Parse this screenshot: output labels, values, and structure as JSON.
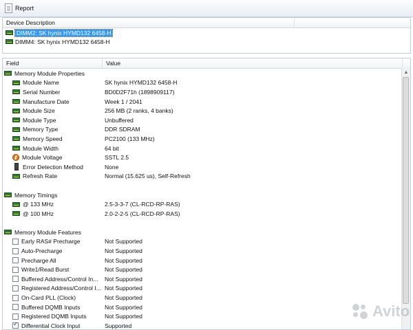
{
  "toolbar": {
    "report_label": "Report"
  },
  "devices": {
    "header": "Device Description",
    "items": [
      {
        "label": "DIMM2: SK hynix HYMD132 6458-H",
        "selected": true
      },
      {
        "label": "DIMM4: SK hynix HYMD132 6458-H",
        "selected": false
      }
    ]
  },
  "details": {
    "columns": {
      "field": "Field",
      "value": "Value"
    },
    "groups": [
      {
        "title": "Memory Module Properties",
        "rows": [
          {
            "field": "Module Name",
            "value": "SK hynix HYMD132 6458-H",
            "icon": "ram-icon"
          },
          {
            "field": "Serial Number",
            "value": "BD0D2F71h (1898909117)",
            "icon": "ram-icon"
          },
          {
            "field": "Manufacture Date",
            "value": "Week 1 / 2041",
            "icon": "ram-icon"
          },
          {
            "field": "Module Size",
            "value": "256 MB (2 ranks, 4 banks)",
            "icon": "ram-icon"
          },
          {
            "field": "Module Type",
            "value": "Unbuffered",
            "icon": "ram-icon"
          },
          {
            "field": "Memory Type",
            "value": "DDR SDRAM",
            "icon": "ram-icon"
          },
          {
            "field": "Memory Speed",
            "value": "PC2100 (133 MHz)",
            "icon": "ram-icon"
          },
          {
            "field": "Module Width",
            "value": "64 bit",
            "icon": "ram-icon"
          },
          {
            "field": "Module Voltage",
            "value": "SSTL 2.5",
            "icon": "voltage-icon"
          },
          {
            "field": "Error Detection Method",
            "value": "None",
            "icon": "device-icon"
          },
          {
            "field": "Refresh Rate",
            "value": "Normal (15.625 us), Self-Refresh",
            "icon": "ram-icon"
          }
        ]
      },
      {
        "title": "Memory Timings",
        "rows": [
          {
            "field": "@ 133 MHz",
            "value": "2.5-3-3-7  (CL-RCD-RP-RAS)",
            "icon": "ram-icon"
          },
          {
            "field": "@ 100 MHz",
            "value": "2.0-2-2-5  (CL-RCD-RP-RAS)",
            "icon": "ram-icon"
          }
        ]
      },
      {
        "title": "Memory Module Features",
        "rows": [
          {
            "field": "Early RAS# Precharge",
            "value": "Not Supported",
            "icon": "checkbox-icon",
            "checked": false
          },
          {
            "field": "Auto-Precharge",
            "value": "Not Supported",
            "icon": "checkbox-icon",
            "checked": false
          },
          {
            "field": "Precharge All",
            "value": "Not Supported",
            "icon": "checkbox-icon",
            "checked": false
          },
          {
            "field": "Write1/Read Burst",
            "value": "Not Supported",
            "icon": "checkbox-icon",
            "checked": false
          },
          {
            "field": "Buffered Address/Control In...",
            "value": "Not Supported",
            "icon": "checkbox-icon",
            "checked": false
          },
          {
            "field": "Registered Address/Control I...",
            "value": "Not Supported",
            "icon": "checkbox-icon",
            "checked": false
          },
          {
            "field": "On-Card PLL (Clock)",
            "value": "Not Supported",
            "icon": "checkbox-icon",
            "checked": false
          },
          {
            "field": "Buffered DQMB Inputs",
            "value": "Not Supported",
            "icon": "checkbox-icon",
            "checked": false
          },
          {
            "field": "Registered DQMB Inputs",
            "value": "Not Supported",
            "icon": "checkbox-icon",
            "checked": false
          },
          {
            "field": "Differential Clock Input",
            "value": "Supported",
            "icon": "checkbox-icon",
            "checked": true
          }
        ]
      }
    ]
  },
  "watermark": {
    "text": "Avito"
  }
}
